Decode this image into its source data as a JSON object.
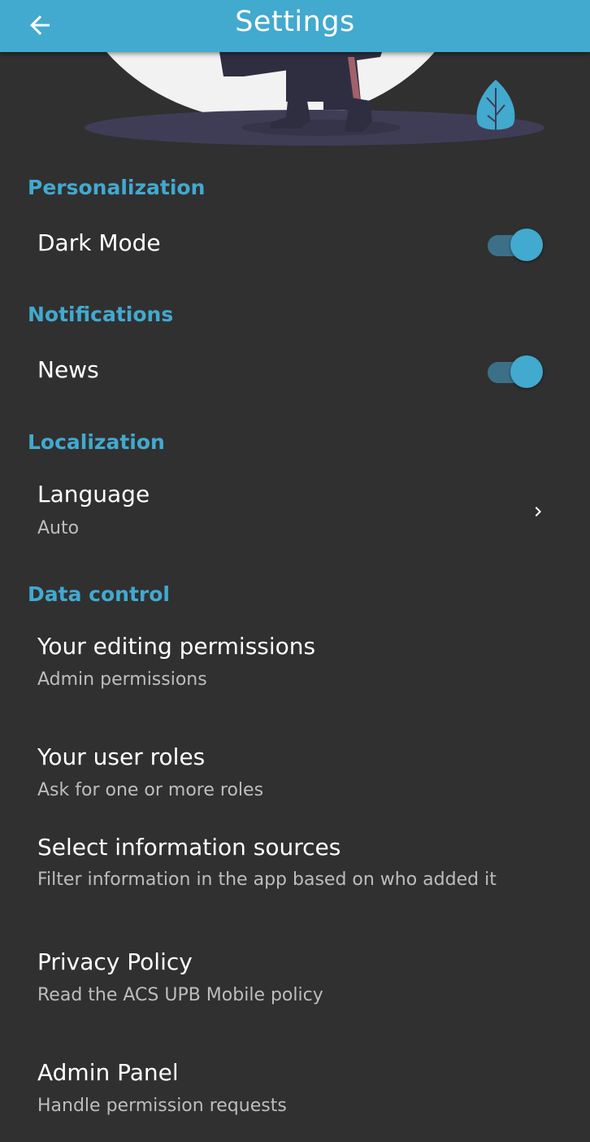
{
  "appbar": {
    "title": "Settings",
    "back_icon": "arrow-left-icon"
  },
  "illustration": {
    "name": "graduation-illustration"
  },
  "personalization": {
    "header": "Personalization",
    "dark_mode": {
      "label": "Dark Mode",
      "enabled": true
    }
  },
  "notifications": {
    "header": "Notifications",
    "news": {
      "label": "News",
      "enabled": true
    }
  },
  "localization": {
    "header": "Localization",
    "language": {
      "label": "Language",
      "value": "Auto",
      "icon": "chevron-right-icon"
    }
  },
  "data_control": {
    "header": "Data control",
    "items": [
      {
        "title": "Your editing permissions",
        "subtitle": "Admin permissions"
      },
      {
        "title": "Your user roles",
        "subtitle": "Ask for one or more roles"
      },
      {
        "title": "Select information sources",
        "subtitle": "Filter information in the app based on who added it"
      },
      {
        "title": "Privacy Policy",
        "subtitle": "Read the ACS UPB Mobile policy"
      },
      {
        "title": "Admin Panel",
        "subtitle": "Handle permission requests"
      }
    ]
  },
  "colors": {
    "accent": "#42a9cf",
    "background": "#303030",
    "switch_track": "#3b7088",
    "subtitle": "#bdbdbd"
  }
}
